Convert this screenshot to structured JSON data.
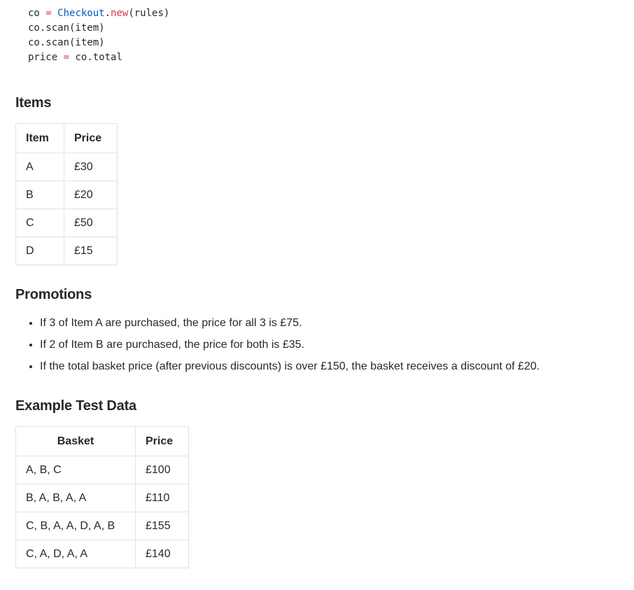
{
  "code": {
    "line1": {
      "var": "co",
      "op": " = ",
      "cls": "Checkout",
      "dot": ".",
      "method": "new",
      "args": "(rules)"
    },
    "line2": "co.scan(item)",
    "line3": "co.scan(item)",
    "line4": {
      "var": "price",
      "op": " = ",
      "rest": "co.total"
    }
  },
  "items": {
    "heading": "Items",
    "headers": [
      "Item",
      "Price"
    ],
    "rows": [
      [
        "A",
        "£30"
      ],
      [
        "B",
        "£20"
      ],
      [
        "C",
        "£50"
      ],
      [
        "D",
        "£15"
      ]
    ]
  },
  "promotions": {
    "heading": "Promotions",
    "list": [
      "If 3 of Item A are purchased, the price for all 3 is £75.",
      "If 2 of Item B are purchased, the price for both is £35.",
      "If the total basket price (after previous discounts) is over £150, the basket receives a discount of £20."
    ]
  },
  "tests": {
    "heading": "Example Test Data",
    "headers": [
      "Basket",
      "Price"
    ],
    "rows": [
      [
        "A, B, C",
        "£100"
      ],
      [
        "B, A, B, A, A",
        "£110"
      ],
      [
        "C, B, A, A, D, A, B",
        "£155"
      ],
      [
        "C, A, D, A, A",
        "£140"
      ]
    ]
  }
}
